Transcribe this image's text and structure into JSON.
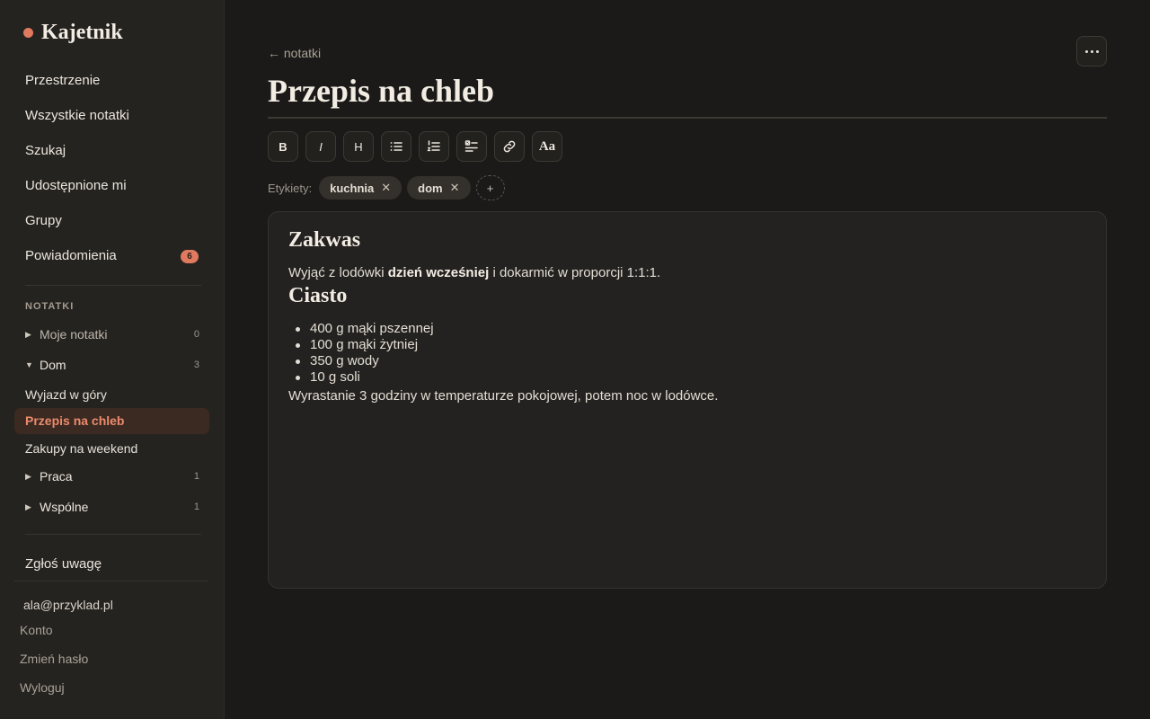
{
  "app": {
    "name": "Kajetnik",
    "accent": "#e07a5f"
  },
  "sidebar": {
    "nav": [
      {
        "label": "Przestrzenie"
      },
      {
        "label": "Wszystkie notatki"
      },
      {
        "label": "Szukaj"
      },
      {
        "label": "Udostępnione mi"
      },
      {
        "label": "Grupy"
      },
      {
        "label": "Powiadomienia",
        "badge": "6"
      }
    ],
    "section_label": "NOTATKI",
    "tree": [
      {
        "label": "Moje notatki",
        "count": "0",
        "expanded": false
      },
      {
        "label": "Dom",
        "count": "3",
        "expanded": true,
        "notes": [
          "Wyjazd w góry",
          "Przepis na chleb",
          "Zakupy na weekend"
        ]
      },
      {
        "label": "Praca",
        "count": "1",
        "expanded": false
      },
      {
        "label": "Wspólne",
        "count": "1",
        "expanded": false
      }
    ],
    "feedback": "Zgłoś uwagę",
    "account": {
      "email": "ala@przyklad.pl",
      "links": [
        "Konto",
        "Zmień hasło",
        "Wyloguj"
      ]
    }
  },
  "main": {
    "back_label": "← notatki",
    "title": "Przepis na chleb",
    "toolbar": {
      "bold": "B",
      "italic": "I",
      "heading": "H",
      "bullet_list": "bullet-list-icon",
      "numbered_list": "numbered-list-icon",
      "checklist": "checklist-icon",
      "link": "link-icon",
      "font": "Aa"
    },
    "tags": {
      "label": "Etykiety:",
      "items": [
        "kuchnia",
        "dom"
      ],
      "remove_glyph": "✕",
      "add_glyph": "+"
    },
    "content": {
      "h1": "Zakwas",
      "p1_pre": "Wyjąć z lodówki ",
      "p1_bold": "dzień wcześniej",
      "p1_post": " i dokarmić w proporcji 1:1:1.",
      "h2": "Ciasto",
      "list": [
        "400 g mąki pszennej",
        "100 g mąki żytniej",
        "350 g wody",
        "10 g soli"
      ],
      "p2": "Wyrastanie 3 godziny w temperaturze pokojowej, potem noc w lodówce."
    }
  }
}
